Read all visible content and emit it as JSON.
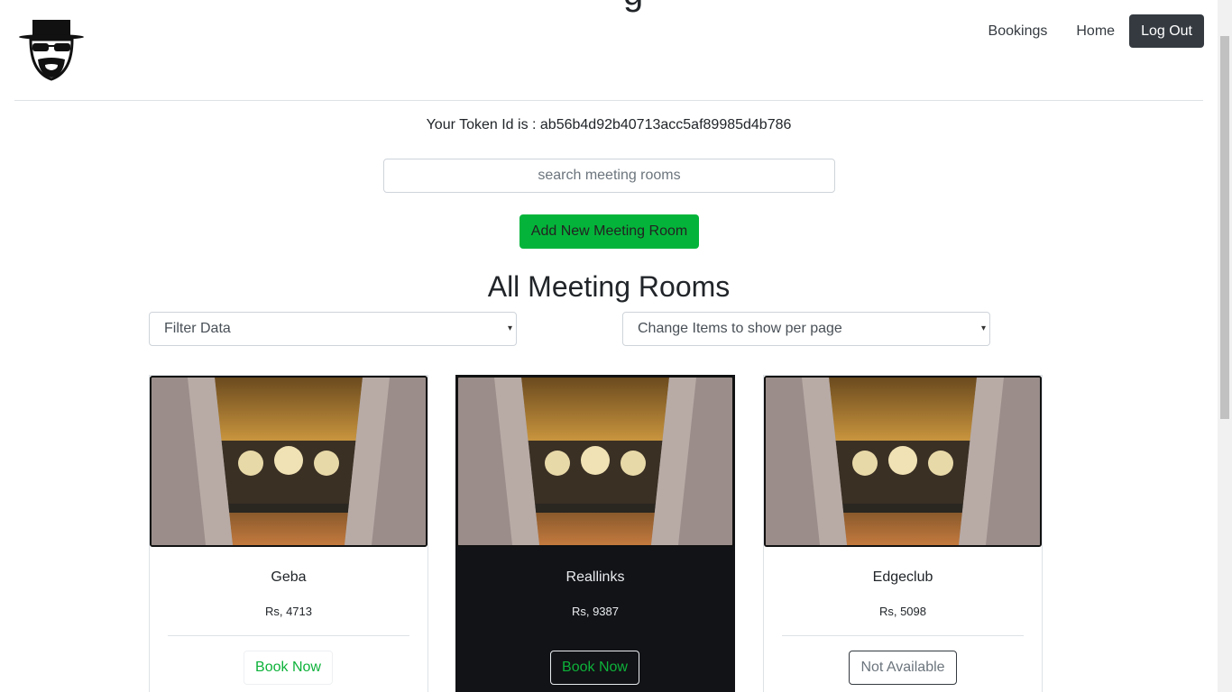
{
  "header": {
    "cut_title": "g",
    "nav": {
      "bookings": "Bookings",
      "home": "Home",
      "logout": "Log Out"
    }
  },
  "token": {
    "text": "Your Token Id is : ab56b4d92b40713acc5af89985d4b786"
  },
  "search": {
    "placeholder": "search meeting rooms"
  },
  "actions": {
    "add_room": "Add New Meeting Room"
  },
  "main": {
    "heading": "All Meeting Rooms",
    "filter_select": "Filter Data",
    "per_page_select": "Change Items to show per page"
  },
  "rooms": [
    {
      "name": "Geba",
      "price": "Rs, 4713",
      "action": "Book Now",
      "available": true
    },
    {
      "name": "Reallinks",
      "price": "Rs, 9387",
      "action": "Book Now",
      "available": true
    },
    {
      "name": "Edgeclub",
      "price": "Rs, 5098",
      "action": "Not Available",
      "available": false
    }
  ],
  "colors": {
    "primary_dark": "#343a40",
    "success": "#04b43a",
    "book_text": "#0db23a"
  }
}
